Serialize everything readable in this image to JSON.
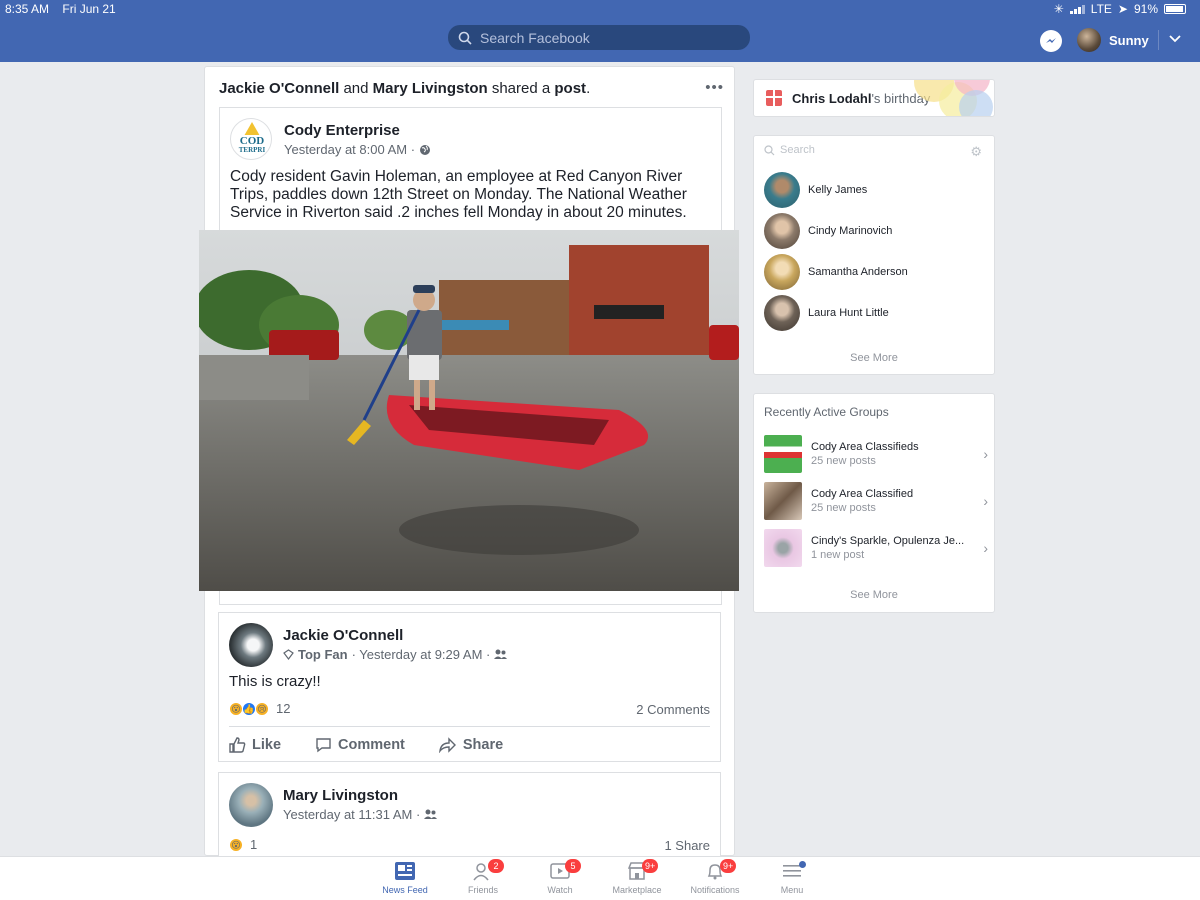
{
  "status": {
    "time": "8:35 AM",
    "date": "Fri Jun 21",
    "network": "LTE",
    "battery": "91%"
  },
  "header": {
    "search_placeholder": "Search Facebook",
    "user_name": "Sunny"
  },
  "post": {
    "sharer_1": "Jackie O'Connell",
    "and": " and ",
    "sharer_2": "Mary Livingston",
    "shared_a": " shared a ",
    "post_word": "post",
    "period": ".",
    "page_name": "Cody Enterprise",
    "page_logo_text_top": "COD",
    "page_logo_text_mid": "TERPRI",
    "page_time": "Yesterday at 8:00 AM ·",
    "text": "Cody resident Gavin Holeman, an employee at Red Canyon River Trips, paddles down 12th Street on Monday. The National Weather Service in Riverton said .2 inches fell Monday in about 20 minutes."
  },
  "comment_1": {
    "name": "Jackie O'Connell",
    "badge": "Top Fan",
    "time": "· Yesterday at 9:29 AM ·",
    "text": "This is crazy!!",
    "reaction_count": "12",
    "comments": "2 Comments",
    "actions": {
      "like": "Like",
      "comment": "Comment",
      "share": "Share"
    }
  },
  "comment_2": {
    "name": "Mary Livingston",
    "time": "Yesterday at 11:31 AM ·",
    "reaction_count": "1",
    "shares": "1 Share"
  },
  "birthday": {
    "name": "Chris Lodahl",
    "suffix": "'s birthday"
  },
  "chat": {
    "search_placeholder": "Search",
    "contacts": [
      {
        "name": "Kelly James",
        "color": "#3a7c8c"
      },
      {
        "name": "Cindy Marinovich",
        "color": "#8c7a6a"
      },
      {
        "name": "Samantha Anderson",
        "color": "#c9a75e"
      },
      {
        "name": "Laura Hunt Little",
        "color": "#6e6257"
      }
    ],
    "see_more": "See More"
  },
  "groups": {
    "title": "Recently Active Groups",
    "items": [
      {
        "name": "Cody Area Classifieds",
        "posts": "25 new posts",
        "color": "#4caf50"
      },
      {
        "name": "Cody Area Classified",
        "posts": "25 new posts",
        "color": "#a88d74"
      },
      {
        "name": "Cindy's Sparkle, Opulenza Je...",
        "posts": "1 new post",
        "color": "#e9c7e3"
      }
    ],
    "see_more": "See More"
  },
  "tabbar": {
    "tabs": [
      {
        "label": "News Feed",
        "badge": ""
      },
      {
        "label": "Friends",
        "badge": "2"
      },
      {
        "label": "Watch",
        "badge": "5"
      },
      {
        "label": "Marketplace",
        "badge": "9+"
      },
      {
        "label": "Notifications",
        "badge": "9+"
      },
      {
        "label": "Menu",
        "badge": ""
      }
    ]
  },
  "colors": {
    "brand": "#4267b2",
    "badge": "#fa3e3e"
  }
}
